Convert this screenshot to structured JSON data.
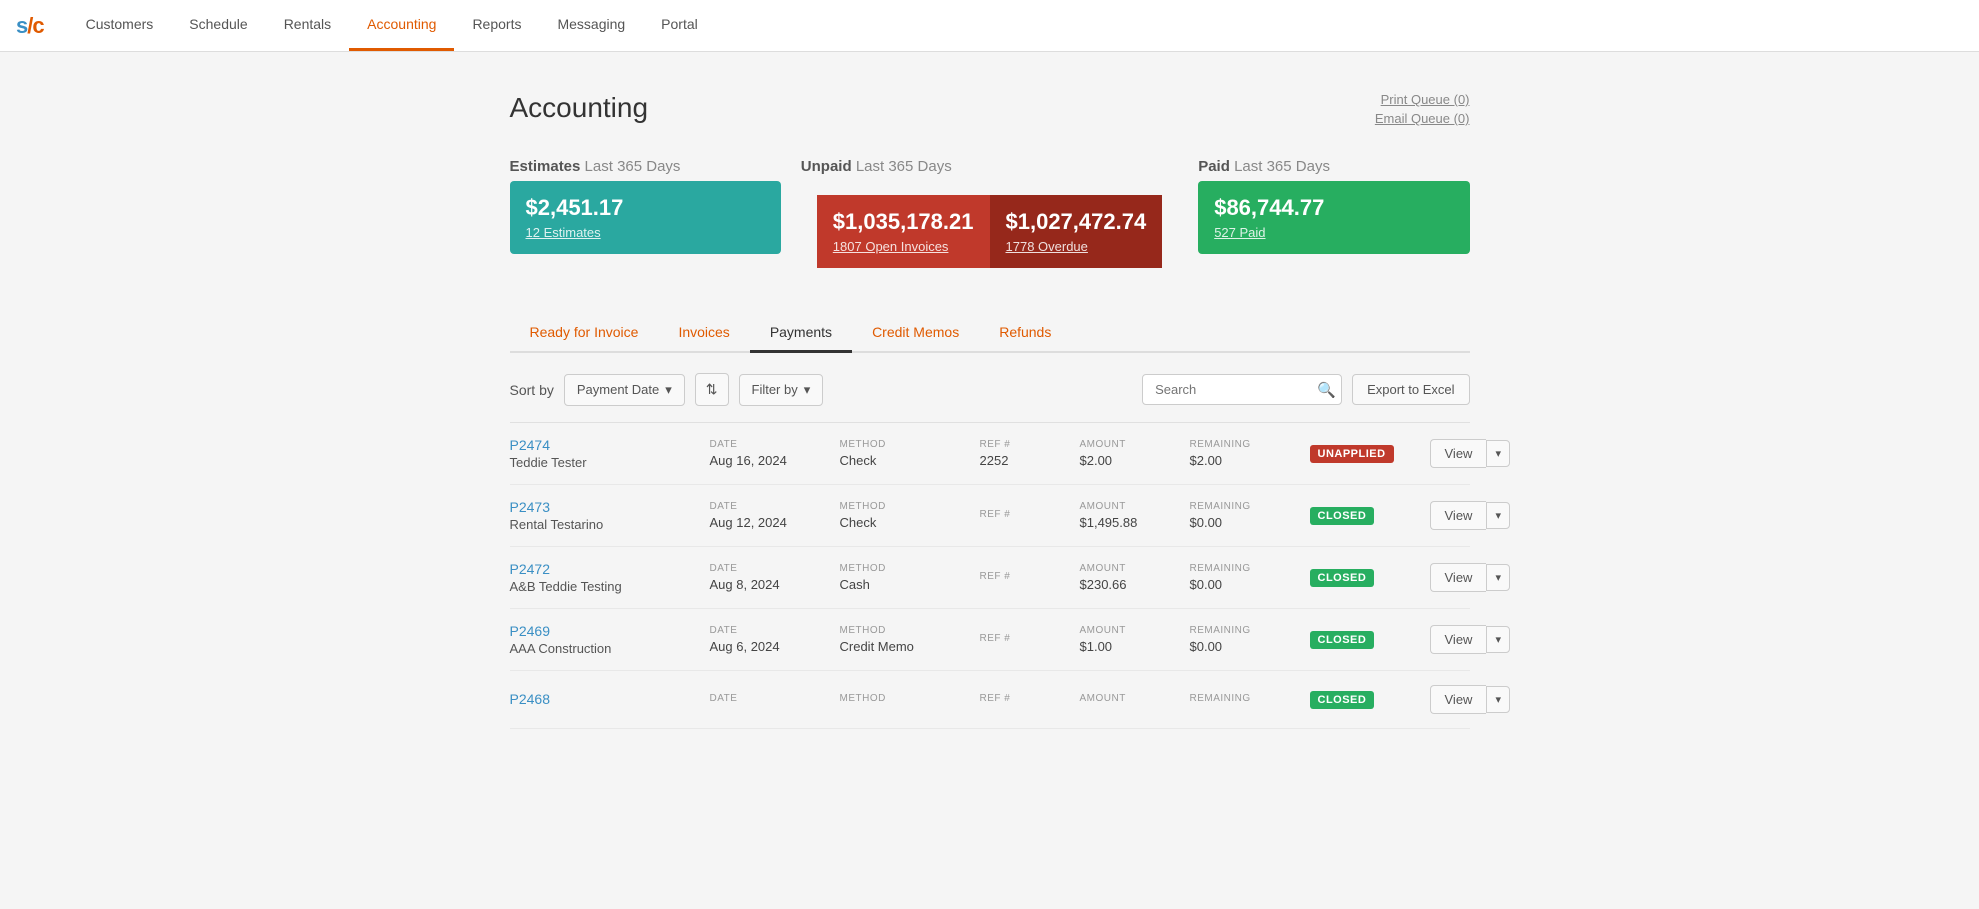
{
  "nav": {
    "logo": "s/c",
    "items": [
      {
        "label": "Customers",
        "active": false
      },
      {
        "label": "Schedule",
        "active": false
      },
      {
        "label": "Rentals",
        "active": false
      },
      {
        "label": "Accounting",
        "active": true
      },
      {
        "label": "Reports",
        "active": false
      },
      {
        "label": "Messaging",
        "active": false
      },
      {
        "label": "Portal",
        "active": false
      }
    ]
  },
  "page": {
    "title": "Accounting",
    "print_queue": "Print Queue (0)",
    "email_queue": "Email Queue (0)"
  },
  "summary": {
    "estimates": {
      "label": "Estimates",
      "period": "Last 365 Days",
      "amount": "$2,451.17",
      "link": "12 Estimates"
    },
    "unpaid": {
      "label": "Unpaid",
      "period": "Last 365 Days",
      "open_amount": "$1,035,178.21",
      "open_link": "1807 Open Invoices",
      "overdue_amount": "$1,027,472.74",
      "overdue_link": "1778 Overdue"
    },
    "paid": {
      "label": "Paid",
      "period": "Last 365 Days",
      "amount": "$86,744.77",
      "link": "527 Paid"
    }
  },
  "tabs": [
    {
      "label": "Ready for Invoice",
      "active": false
    },
    {
      "label": "Invoices",
      "active": false
    },
    {
      "label": "Payments",
      "active": true
    },
    {
      "label": "Credit Memos",
      "active": false
    },
    {
      "label": "Refunds",
      "active": false
    }
  ],
  "controls": {
    "sort_label": "Sort by",
    "sort_by": "Payment Date",
    "filter_label": "Filter by",
    "search_placeholder": "Search",
    "export_label": "Export to Excel"
  },
  "payments": [
    {
      "id": "P2474",
      "customer": "Teddie Tester",
      "date_label": "DATE",
      "date": "Aug 16, 2024",
      "method_label": "METHOD",
      "method": "Check",
      "ref_label": "REF #",
      "ref": "2252",
      "amount_label": "AMOUNT",
      "amount": "$2.00",
      "remaining_label": "REMAINING",
      "remaining": "$2.00",
      "status": "UNAPPLIED",
      "status_type": "unapplied",
      "view_label": "View"
    },
    {
      "id": "P2473",
      "customer": "Rental Testarino",
      "date_label": "DATE",
      "date": "Aug 12, 2024",
      "method_label": "METHOD",
      "method": "Check",
      "ref_label": "REF #",
      "ref": "",
      "amount_label": "AMOUNT",
      "amount": "$1,495.88",
      "remaining_label": "REMAINING",
      "remaining": "$0.00",
      "status": "CLOSED",
      "status_type": "closed",
      "view_label": "View"
    },
    {
      "id": "P2472",
      "customer": "A&B Teddie Testing",
      "date_label": "DATE",
      "date": "Aug 8, 2024",
      "method_label": "METHOD",
      "method": "Cash",
      "ref_label": "REF #",
      "ref": "",
      "amount_label": "AMOUNT",
      "amount": "$230.66",
      "remaining_label": "REMAINING",
      "remaining": "$0.00",
      "status": "CLOSED",
      "status_type": "closed",
      "view_label": "View"
    },
    {
      "id": "P2469",
      "customer": "AAA Construction",
      "date_label": "DATE",
      "date": "Aug 6, 2024",
      "method_label": "METHOD",
      "method": "Credit Memo",
      "ref_label": "REF #",
      "ref": "",
      "amount_label": "AMOUNT",
      "amount": "$1.00",
      "remaining_label": "REMAINING",
      "remaining": "$0.00",
      "status": "CLOSED",
      "status_type": "closed",
      "view_label": "View"
    },
    {
      "id": "P2468",
      "customer": "",
      "date_label": "DATE",
      "date": "",
      "method_label": "METHOD",
      "method": "",
      "ref_label": "REF #",
      "ref": "",
      "amount_label": "AMOUNT",
      "amount": "",
      "remaining_label": "REMAINING",
      "remaining": "",
      "status": "CLOSED",
      "status_type": "closed",
      "view_label": "View"
    }
  ]
}
